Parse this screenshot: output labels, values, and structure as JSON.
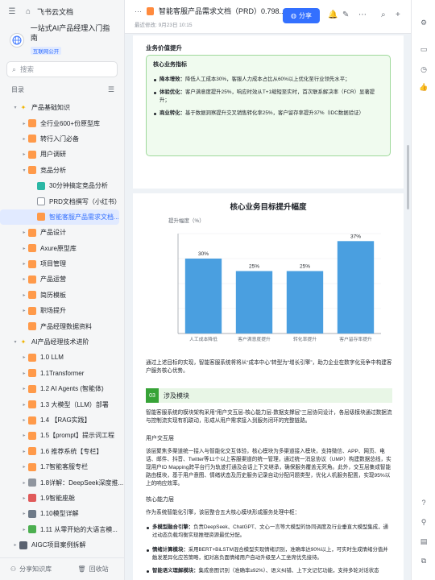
{
  "sidebar": {
    "app_title": "飞书云文档",
    "space_name": "一站式AI产品经理入门指南",
    "space_badge": "互联网公开",
    "search_placeholder": "搜索",
    "toc_label": "目录",
    "items": [
      {
        "label": "产品基础知识",
        "level": 0,
        "arrow": "▾",
        "icon": "none"
      },
      {
        "label": "全行业600+份原型库",
        "level": 1,
        "arrow": "▸",
        "icon": "orange"
      },
      {
        "label": "转行入门必备",
        "level": 1,
        "arrow": "▸",
        "icon": "orange"
      },
      {
        "label": "用户调研",
        "level": 1,
        "arrow": "▸",
        "icon": "orange"
      },
      {
        "label": "竞品分析",
        "level": 1,
        "arrow": "▾",
        "icon": "orange"
      },
      {
        "label": "30分钟搞定竞品分析",
        "level": 2,
        "arrow": "",
        "icon": "teal"
      },
      {
        "label": "PRD文档撰写（小红书）",
        "level": 2,
        "arrow": "",
        "icon": "doc"
      },
      {
        "label": "智能客服产品需求文档...",
        "level": 2,
        "arrow": "",
        "icon": "orange",
        "selected": true
      },
      {
        "label": "产品设计",
        "level": 1,
        "arrow": "▸",
        "icon": "orange"
      },
      {
        "label": "Axure原型库",
        "level": 1,
        "arrow": "▸",
        "icon": "orange"
      },
      {
        "label": "项目管理",
        "level": 1,
        "arrow": "▸",
        "icon": "orange"
      },
      {
        "label": "产品运营",
        "level": 1,
        "arrow": "▸",
        "icon": "orange"
      },
      {
        "label": "简历模板",
        "level": 1,
        "arrow": "▸",
        "icon": "orange"
      },
      {
        "label": "职场提升",
        "level": 1,
        "arrow": "▸",
        "icon": "orange"
      },
      {
        "label": "产品经理数据资料",
        "level": 1,
        "arrow": "",
        "icon": "orange"
      },
      {
        "label": "AI产品经理技术进阶",
        "level": 0,
        "arrow": "▾",
        "icon": "none"
      },
      {
        "label": "1.0 LLM",
        "level": 1,
        "arrow": "▸",
        "icon": "orange"
      },
      {
        "label": "1.1Transformer",
        "level": 1,
        "arrow": "▸",
        "icon": "orange"
      },
      {
        "label": "1.2 AI Agents (智能体)",
        "level": 1,
        "arrow": "▸",
        "icon": "orange"
      },
      {
        "label": "1.3 大模型（LLM）部署",
        "level": 1,
        "arrow": "▸",
        "icon": "orange"
      },
      {
        "label": "1.4 【RAG实践】",
        "level": 1,
        "arrow": "▸",
        "icon": "orange"
      },
      {
        "label": "1.5【prompt】提示词工程",
        "level": 1,
        "arrow": "▸",
        "icon": "orange"
      },
      {
        "label": "1.6 推荐系统【专栏】",
        "level": 1,
        "arrow": "▸",
        "icon": "orange"
      },
      {
        "label": "1.7智能客服专栏",
        "level": 1,
        "arrow": "▸",
        "icon": "orange"
      },
      {
        "label": "1.8详解：DeepSeek深度推...",
        "level": 1,
        "arrow": "▸",
        "icon": "gear"
      },
      {
        "label": "1.9智能座舱",
        "level": 1,
        "arrow": "▸",
        "icon": "car"
      },
      {
        "label": "1.10模型详解",
        "level": 1,
        "arrow": "▸",
        "icon": "tool"
      },
      {
        "label": "1.11 从零开始的大语言模...",
        "level": 1,
        "arrow": "▸",
        "icon": "plant"
      },
      {
        "label": "AIGC项目案例拆解",
        "level": 0,
        "arrow": "▸",
        "icon": "dark"
      }
    ],
    "bottom_left": "分享知识库",
    "bottom_right": "回收站"
  },
  "header": {
    "doc_title": "智能客服产品需求文档（PRD）0.798...",
    "last_modified": "最近修改: 9月23日 10:15",
    "share_label": "分享"
  },
  "page1": {
    "section_label": "业务价值提升",
    "callout_title": "核心业务指标",
    "bullets": [
      {
        "bold": "降本增效：",
        "text": "降低人工成本30%，客服人力成本占比从60%以上优化至行业领先水平；"
      },
      {
        "bold": "体验优化：",
        "text": "客户满意度提升25%，响应时效从T+1缩短至实时，首次联系解决率（FCR）显著提升；"
      },
      {
        "bold": "商业转化：",
        "text": "基于数据洞察提升交叉销售转化率25%，客户留存率提升37%（IDC数据验证）"
      }
    ]
  },
  "chart_data": {
    "type": "bar",
    "title": "核心业务目标提升幅度",
    "ylabel": "提升幅度（%）",
    "categories": [
      "人工成本降低",
      "客户满意度提升",
      "转化率提升",
      "客户留存率提升"
    ],
    "values": [
      30,
      25,
      25,
      37
    ],
    "value_labels": [
      "30%",
      "25%",
      "25%",
      "37%"
    ],
    "ylim": [
      0,
      40
    ],
    "bar_color": "#4a9fe0",
    "grid": true
  },
  "page2": {
    "summary": "通过上述目标的实现，智能客服系统将将从“成本中心”转型为“增长引擎”，助力企业在数字化竞争中构建客户服务核心优势。",
    "section_num": "03",
    "section_title": "涉及模块",
    "intro": "智能客服系统的模块架构采用“用户交互层-核心能力层-数据支撑层”三层协同设计，各层级模块通过数据流与控制流实现有机联动，形成从用户需求接入到服务闭环的完整链路。",
    "layer1_title": "用户交互层",
    "layer1_text": "该层聚焦多渠道统一接入与智能化交互体验，核心模块为多渠道接入模块，支持微信、APP、网页、电话、邮件、抖音、Twitter等11个以上客服渠道的统一管理，通过统一消息协议（UMP）构建数据总线，实现用户ID Mapping跨平台行为轨迹打通及会话上下文继承，确保服务覆盖无死角。此外，交互层集成智能路由模块，基于用户意图、情绪状态及历史服务记录自动分配问题类型，优化人机服务配置，实现95%以上的响应效率。",
    "layer2_title": "核心能力层",
    "layer2_text": "作为系统智能化引擎，该层整合五大核心模块形成服务处理中枢：",
    "layer2_bullets": [
      {
        "bold": "多模型融合引擎：",
        "text": "负责DeepSeek、ChatGPT、文心一言等大模型的协同调度及行业垂直大模型集成，通过动态负载均衡实现推理资源最优分配。"
      },
      {
        "bold": "情绪计算模块：",
        "text": "采用BERT+BiLSTM混合模型实现情绪识别，准确率达90%以上，可实时生成情绪分值并触发差异化应答策略，如对高负面情绪用户自动升级至人工坐席优先接待。"
      },
      {
        "bold": "智能语义理解模块：",
        "text": "集成意图识别（准确率≥92%）、语义纠错、上下文记忆功能，支持多轮对话状态"
      }
    ]
  }
}
